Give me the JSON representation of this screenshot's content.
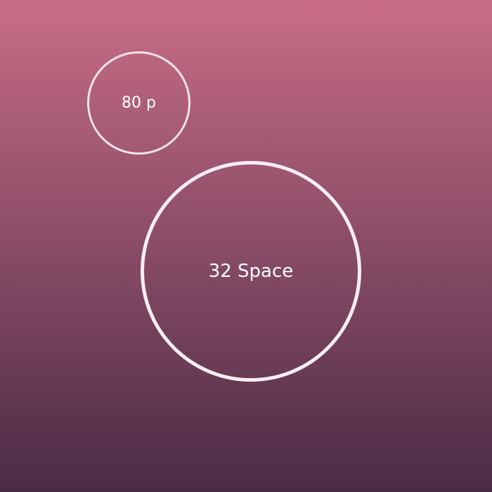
{
  "colors": {
    "gradient_top": "#c96d86",
    "gradient_bottom": "#4a2b45",
    "ring": "#fbeef2",
    "text": "#ffffff"
  },
  "bubbles": [
    {
      "label": "80 p"
    },
    {
      "label": "32 Space"
    }
  ]
}
